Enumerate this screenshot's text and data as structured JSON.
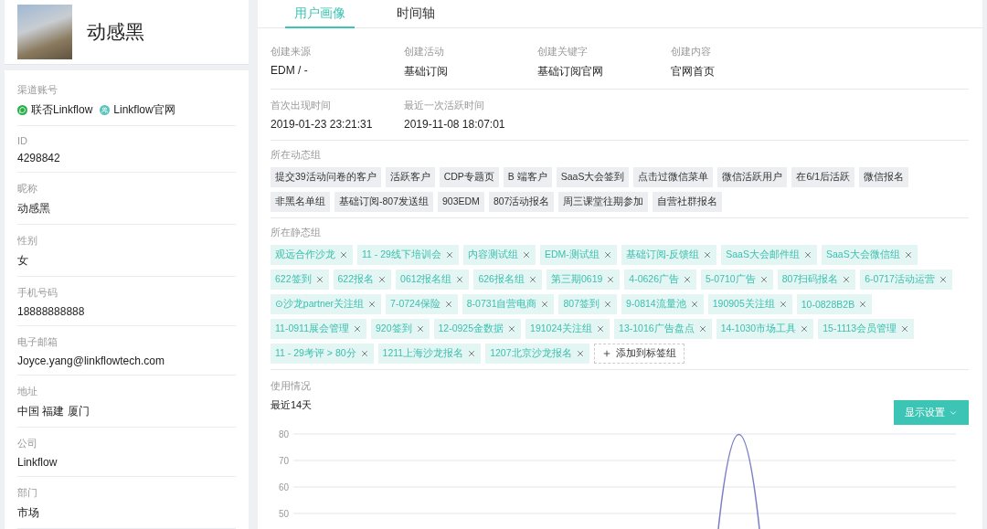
{
  "profile": {
    "name": "动感黑"
  },
  "fields": [
    {
      "kind": "channels",
      "label": "渠道账号",
      "channels": [
        {
          "kind": "chat",
          "name": "联否Linkflow"
        },
        {
          "kind": "people",
          "name": "Linkflow官网"
        }
      ]
    },
    {
      "kind": "text",
      "label": "ID",
      "value": "4298842"
    },
    {
      "kind": "text",
      "label": "昵称",
      "value": "动感黑"
    },
    {
      "kind": "text",
      "label": "性别",
      "value": "女"
    },
    {
      "kind": "text",
      "label": "手机号码",
      "value": "18888888888"
    },
    {
      "kind": "text",
      "label": "电子邮箱",
      "value": "Joyce.yang@linkflowtech.com"
    },
    {
      "kind": "text",
      "label": "地址",
      "value": "中国 福建 厦门"
    },
    {
      "kind": "text",
      "label": "公司",
      "value": "Linkflow"
    },
    {
      "kind": "text",
      "label": "部门",
      "value": "市场"
    }
  ],
  "tabs": [
    {
      "label": "用户画像",
      "selected": true
    },
    {
      "label": "时间轴",
      "selected": false
    }
  ],
  "info_rows": [
    [
      {
        "label": "创建来源",
        "value": "EDM / -"
      },
      {
        "label": "创建活动",
        "value": "基础订阅"
      },
      {
        "label": "创建关键字",
        "value": "基础订阅官网"
      },
      {
        "label": "创建内容",
        "value": "官网首页"
      }
    ],
    [
      {
        "label": "首次出现时间",
        "value": "2019-01-23 23:21:31"
      },
      {
        "label": "最近一次活跃时间",
        "value": "2019-11-08 18:07:01"
      }
    ]
  ],
  "dynamic_groups": {
    "title": "所在动态组",
    "tags": [
      "提交39活动问卷的客户",
      "活跃客户",
      "CDP专题页",
      "B 端客户",
      "SaaS大会签到",
      "点击过微信菜单",
      "微信活跃用户",
      "在6/1后活跃",
      "微信报名",
      "非黑名单组",
      "基础订阅-807发送组",
      "903EDM",
      "807活动报名",
      "周三课堂往期参加",
      "自营社群报名"
    ]
  },
  "static_groups": {
    "title": "所在静态组",
    "tags": [
      "观远合作沙龙",
      "11 - 29线下培训会",
      "内容测试组",
      "EDM-测试组",
      "基础订阅-反馈组",
      "SaaS大会邮件组",
      "SaaS大会微信组",
      "622签到",
      "622报名",
      "0612报名组",
      "626报名组",
      "第三期0619",
      "4-0626广告",
      "5-0710广告",
      "807扫码报名",
      "6-0717活动运营",
      "⊙沙龙partner关注组",
      "7-0724保险",
      "8-0731自营电商",
      "807签到",
      "9-0814流量池",
      "190905关注组",
      "10-0828B2B",
      "11-0911展会管理",
      "920签到",
      "12-0925金数据",
      "191024关注组",
      "13-1016广告盘点",
      "14-1030市场工具",
      "15-1113会员管理",
      "11 - 29考评 > 80分",
      "1211上海沙龙报名",
      "1207北京沙龙报名"
    ],
    "add_label": "添加到标签组"
  },
  "usage": {
    "title": "使用情况",
    "period": "最近14天",
    "settings_button": "显示设置",
    "y_ticks": [
      "80",
      "70",
      "60",
      "50"
    ]
  }
}
